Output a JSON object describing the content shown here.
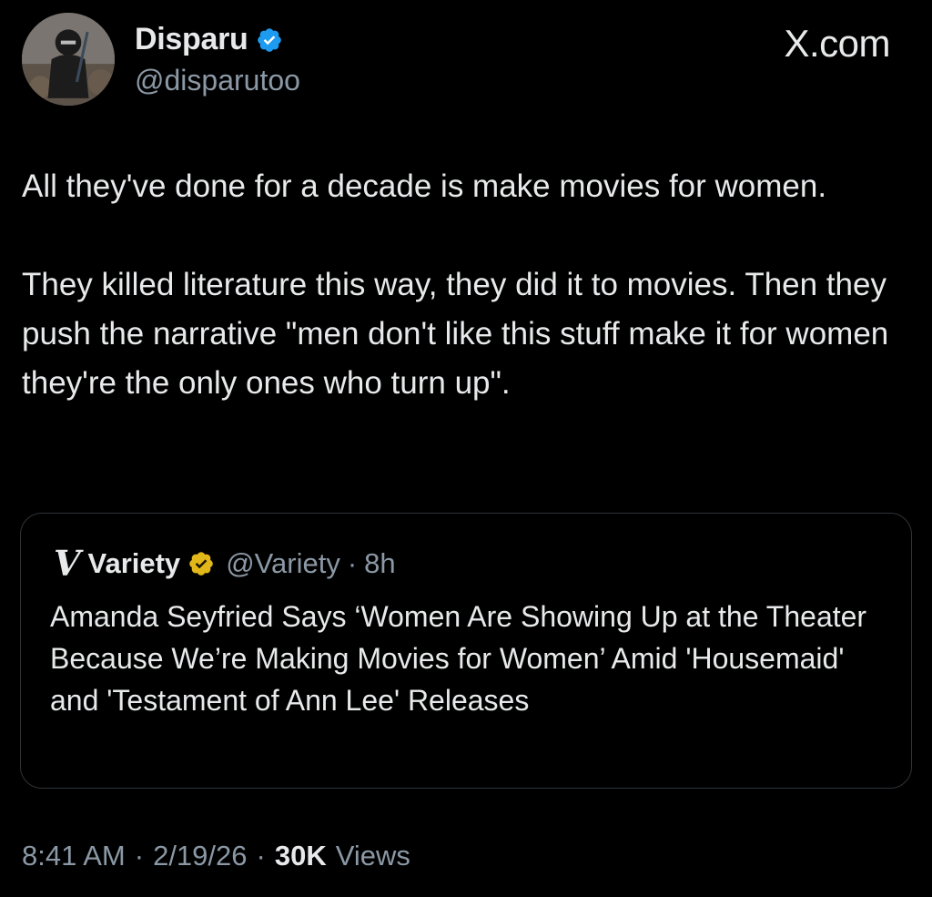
{
  "author": {
    "name": "Disparu",
    "handle": "@disparutoo"
  },
  "brand": "X.com",
  "tweet": {
    "paragraphs": [
      "All they've done for a decade is make movies for women.",
      "They killed literature this way, they did it to movies. Then they push the narrative \"men don't like this stuff make it for women they're the only ones who turn up\"."
    ]
  },
  "quote": {
    "logo": "V",
    "name": "Variety",
    "handle": "@Variety",
    "separator": "·",
    "time": "8h",
    "text": "Amanda Seyfried Says ‘Women Are Showing Up at the Theater Because We’re Making Movies for Women’ Amid 'Housemaid' and 'Testament of Ann Lee' Releases"
  },
  "meta": {
    "time": "8:41 AM",
    "sep1": "·",
    "date": "2/19/26",
    "sep2": "·",
    "views_count": "30K",
    "views_label": "Views"
  },
  "colors": {
    "background": "#000000",
    "text": "#e7e9ea",
    "muted": "#8b98a5",
    "verified_blue": "#1d9bf0",
    "verified_gold": "#e2b719",
    "border": "#2f3336"
  },
  "icons": {
    "verified": "verified-badge-icon",
    "gold_verified": "gold-verified-badge-icon"
  }
}
